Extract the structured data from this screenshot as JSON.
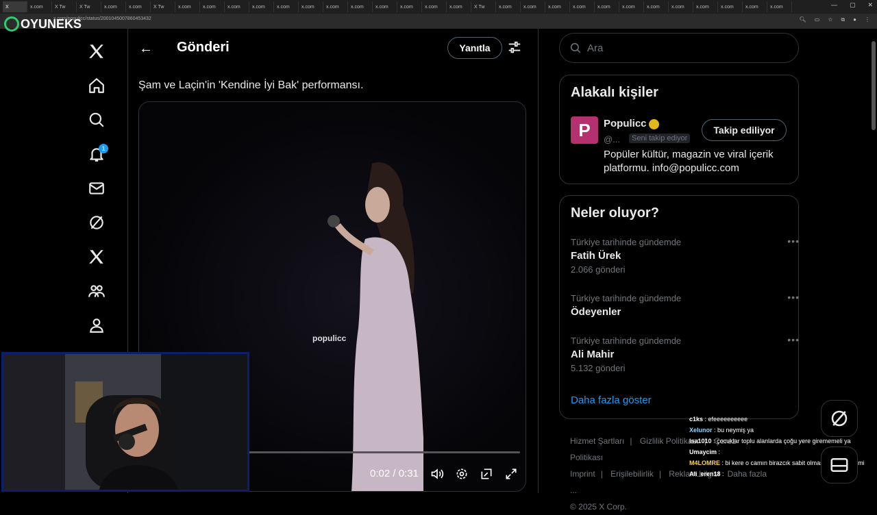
{
  "browser": {
    "tabs": [
      "X",
      "x.com",
      "X Tw",
      "X Tw",
      "x.com",
      "x.com",
      "X Tw",
      "x.com",
      "x.com",
      "x.com",
      "x.com",
      "x.com",
      "x.com",
      "x.com",
      "x.com",
      "x.com",
      "x.com",
      "x.com",
      "x.com",
      "X Tw",
      "x.com",
      "x.com",
      "x.com",
      "x.com",
      "x.com",
      "x.com",
      "x.com",
      "x.com",
      "x.com",
      "x.com",
      "x.com",
      "x.com"
    ],
    "url": "x.com/populicc/status/2001045007860453432"
  },
  "watermark": {
    "text": "OYUNEKS"
  },
  "header": {
    "title": "Gönderi",
    "reply_label": "Yanıtla"
  },
  "notifications": {
    "badge": "1"
  },
  "post": {
    "text": "Şam ve Laçin'in 'Kendine İyi Bak' performansı."
  },
  "video": {
    "time": "0:02 / 0:31",
    "watermark": "populicc",
    "progress": 0.06
  },
  "search": {
    "placeholder": "Ara"
  },
  "relevant": {
    "title": "Alakalı kişiler",
    "name": "Populicc",
    "handle": "@...",
    "follows_you": "Seni takip ediyor",
    "follow_label": "Takip ediliyor",
    "bio": "Popüler kültür, magazin ve viral içerik platformu. info@populicc.com"
  },
  "trends": {
    "title": "Neler oluyor?",
    "items": [
      {
        "context": "Türkiye tarihinde gündemde",
        "name": "Fatih Ürek",
        "count": "2.066 gönderi"
      },
      {
        "context": "Türkiye tarihinde gündemde",
        "name": "Ödeyenler",
        "count": ""
      },
      {
        "context": "Türkiye tarihinde gündemde",
        "name": "Ali Mahir",
        "count": "5.132 gönderi"
      }
    ],
    "show_more": "Daha fazla göster"
  },
  "footer": {
    "links": [
      "Hizmet Şartları",
      "Gizlilik Politikası",
      "Çerez Politikası",
      "Imprint",
      "Erişilebilirlik",
      "Reklam bilgisi",
      "Daha fazla ..."
    ],
    "copyright": "© 2025 X Corp."
  },
  "chat": [
    {
      "user": "c1ks",
      "msg": "efeeeeeeeeee",
      "color": "#ffffff"
    },
    {
      "user": "Xelunor",
      "msg": "bu neymiş ya",
      "color": "#8fd3ff"
    },
    {
      "user": "isa1010",
      "msg": "çocuklar toplu alanlarda çoğu yere girememeli ya",
      "color": "#ffffff"
    },
    {
      "user": "Umaycim",
      "msg": "",
      "color": "#ffffff"
    },
    {
      "user": "M4LOMRE",
      "msg": "bi kere o camın birazcık sabit olması lazım değil mi",
      "color": "#ffd34d"
    },
    {
      "user": "Ali_eren18",
      "msg": "",
      "color": "#ffffff"
    }
  ],
  "colors": {
    "accent": "#1d9bf0",
    "border": "#2f3336",
    "muted": "#71767b",
    "brand_avatar": "#b5306f"
  }
}
